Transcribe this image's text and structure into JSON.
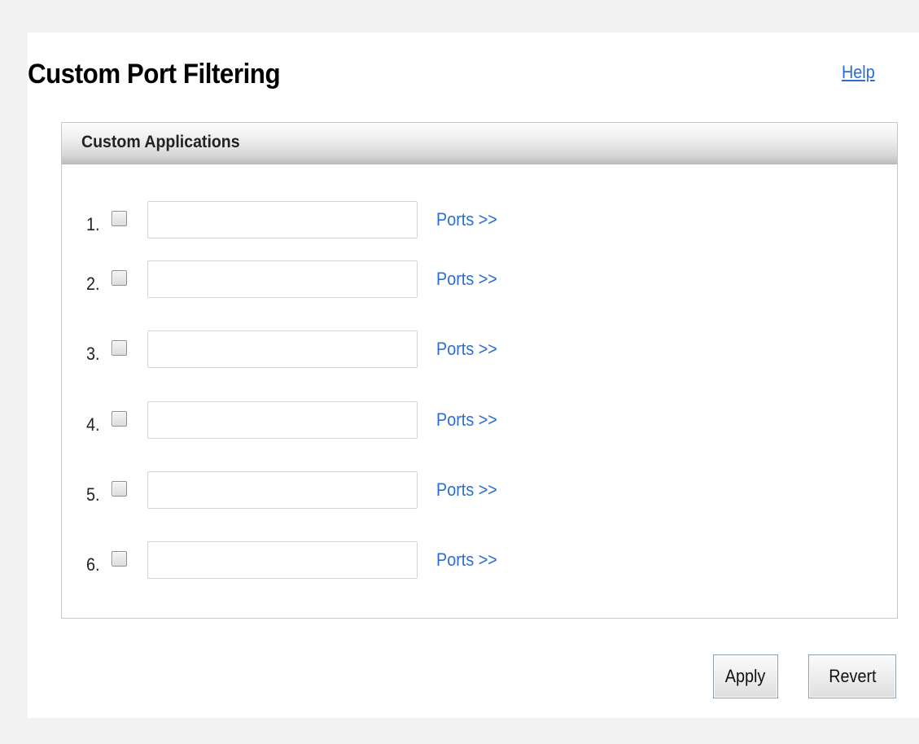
{
  "page": {
    "title": "Custom Port Filtering",
    "help_label": "Help"
  },
  "section": {
    "title": "Custom Applications"
  },
  "rows": [
    {
      "number": "1.",
      "checked": false,
      "value": "",
      "ports_label": "Ports >>"
    },
    {
      "number": "2.",
      "checked": false,
      "value": "",
      "ports_label": "Ports >>"
    },
    {
      "number": "3.",
      "checked": false,
      "value": "",
      "ports_label": "Ports >>"
    },
    {
      "number": "4.",
      "checked": false,
      "value": "",
      "ports_label": "Ports >>"
    },
    {
      "number": "5.",
      "checked": false,
      "value": "",
      "ports_label": "Ports >>"
    },
    {
      "number": "6.",
      "checked": false,
      "value": "",
      "ports_label": "Ports >>"
    }
  ],
  "buttons": {
    "apply_label": "Apply",
    "revert_label": "Revert"
  },
  "colors": {
    "link": "#2a6fd1",
    "page_background": "#f2f2f2",
    "panel_background": "#ffffff"
  }
}
